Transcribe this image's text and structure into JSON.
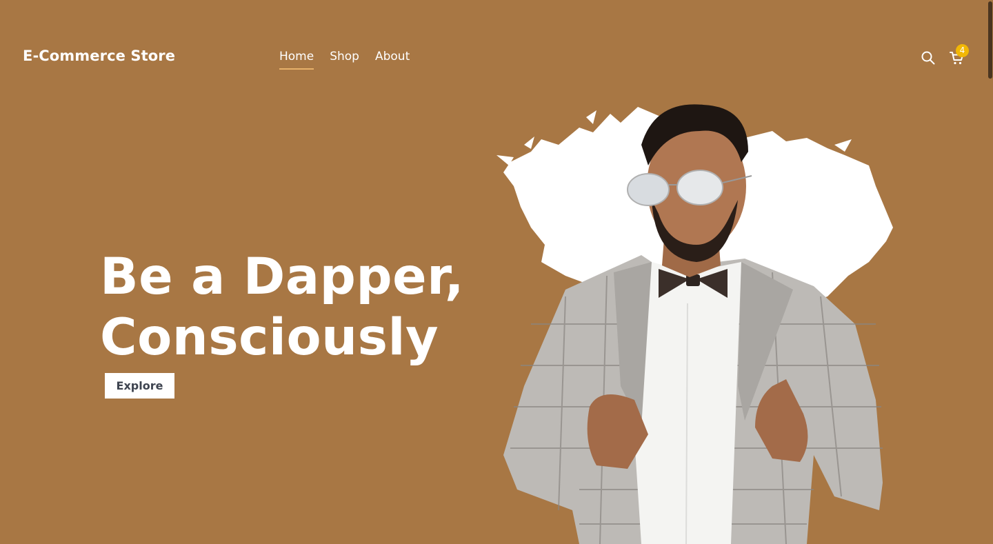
{
  "header": {
    "brand": "E-Commerce Store",
    "nav": [
      {
        "label": "Home",
        "active": true
      },
      {
        "label": "Shop",
        "active": false
      },
      {
        "label": "About",
        "active": false
      }
    ],
    "cart_count": "4",
    "search_icon": "search-icon",
    "cart_icon": "cart-icon"
  },
  "hero": {
    "title_line1": "Be a Dapper,",
    "title_line2": "Consciously",
    "explore_label": "Explore"
  },
  "colors": {
    "background": "#a87744",
    "nav_underline": "#e7b16a",
    "badge": "#f2b705",
    "button_text": "#3e4450"
  }
}
